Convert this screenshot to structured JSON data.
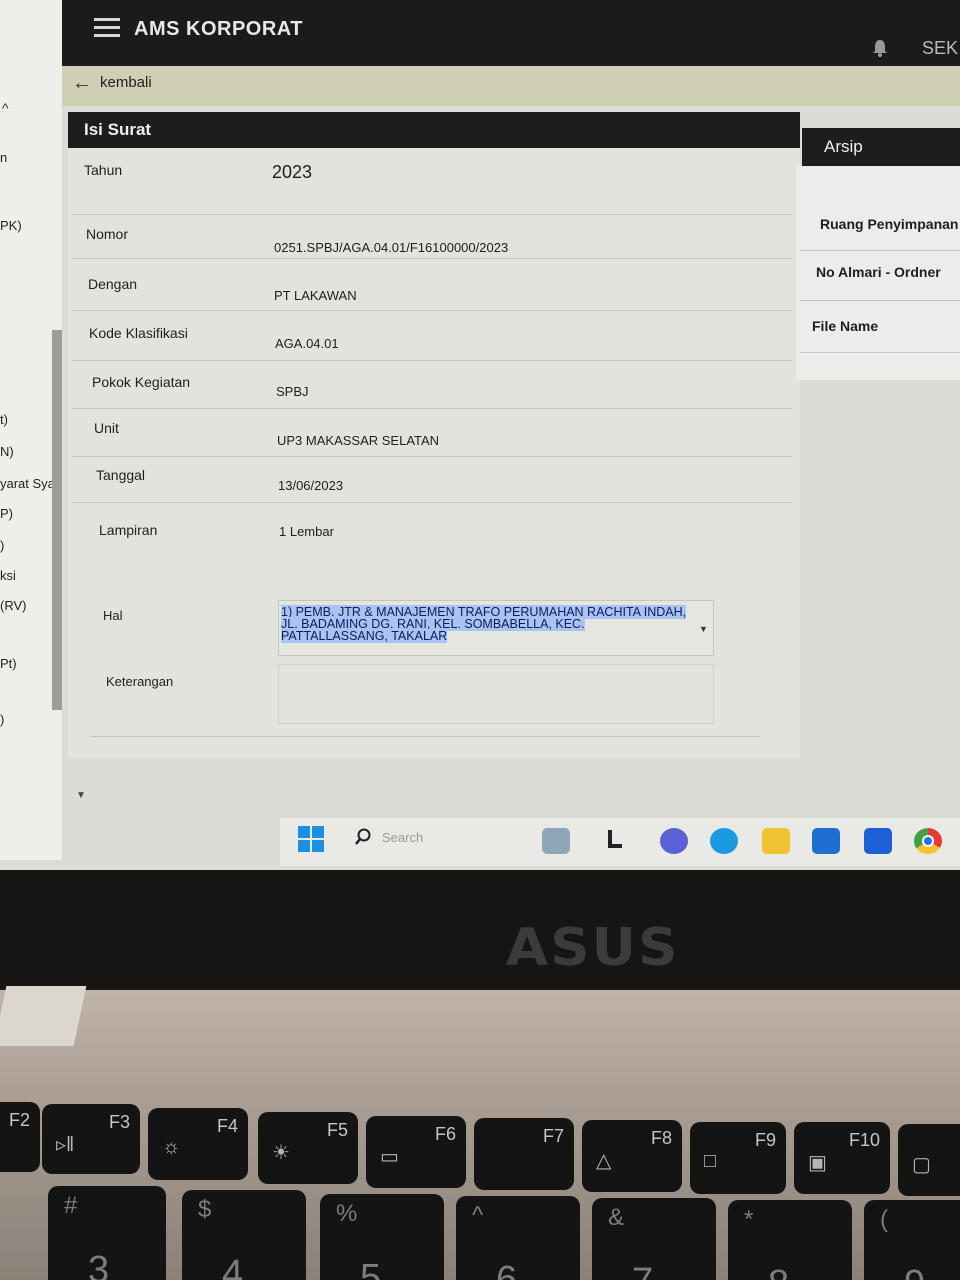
{
  "window": {
    "app_title": "AMS KORPORAT",
    "user_label": "SEK",
    "back_label": "kembali"
  },
  "left_sidebar": {
    "items": [
      "n",
      "PK)",
      "t)",
      "N)",
      "yarat Sya",
      "P)",
      ")",
      "ksi",
      "(RV)",
      "Pt)",
      ")"
    ]
  },
  "form": {
    "title": "Isi Surat",
    "fields": {
      "tahun": {
        "label": "Tahun",
        "value": "2023"
      },
      "nomor": {
        "label": "Nomor",
        "value": "0251.SPBJ/AGA.04.01/F16100000/2023"
      },
      "dengan": {
        "label": "Dengan",
        "value": "PT LAKAWAN"
      },
      "kode_klasifikasi": {
        "label": "Kode Klasifikasi",
        "value": "AGA.04.01"
      },
      "pokok_kegiatan": {
        "label": "Pokok Kegiatan",
        "value": "SPBJ"
      },
      "unit": {
        "label": "Unit",
        "value": "UP3 MAKASSAR SELATAN"
      },
      "tanggal": {
        "label": "Tanggal",
        "value": "13/06/2023"
      },
      "lampiran": {
        "label": "Lampiran",
        "value": "1 Lembar"
      },
      "hal": {
        "label": "Hal",
        "value_lines": [
          "1) PEMB. JTR & MANAJEMEN TRAFO PERUMAHAN RACHITA INDAH,",
          "JL. BADAMING DG. RANI, KEL. SOMBABELLA, KEC.",
          "PATTALLASSANG, TAKALAR"
        ]
      },
      "keterangan": {
        "label": "Keterangan",
        "value": ""
      }
    }
  },
  "arsip": {
    "title": "Arsip",
    "labels": [
      "Ruang Penyimpanan",
      "No Almari - Ordner",
      "File Name"
    ]
  },
  "taskbar": {
    "search_placeholder": "Search",
    "apps": [
      "windows-icon",
      "search-icon",
      "photos-icon",
      "files-icon",
      "teams-icon",
      "edge-icon",
      "file-explorer-icon",
      "mail-icon",
      "store-icon",
      "chrome-icon"
    ]
  },
  "laptop": {
    "brand": "ASUS",
    "keys": [
      {
        "fn": "F2",
        "num": "",
        "sym": ""
      },
      {
        "fn": "F3",
        "num": "3",
        "sym": "#"
      },
      {
        "fn": "F4",
        "num": "4",
        "sym": "$"
      },
      {
        "fn": "F5",
        "num": "5",
        "sym": "%"
      },
      {
        "fn": "F6",
        "num": "6",
        "sym": "^"
      },
      {
        "fn": "F7",
        "num": "7",
        "sym": "&"
      },
      {
        "fn": "F8",
        "num": "8",
        "sym": "*"
      },
      {
        "fn": "F9",
        "num": "9",
        "sym": "("
      },
      {
        "fn": "F10",
        "num": "",
        "sym": ""
      }
    ]
  }
}
